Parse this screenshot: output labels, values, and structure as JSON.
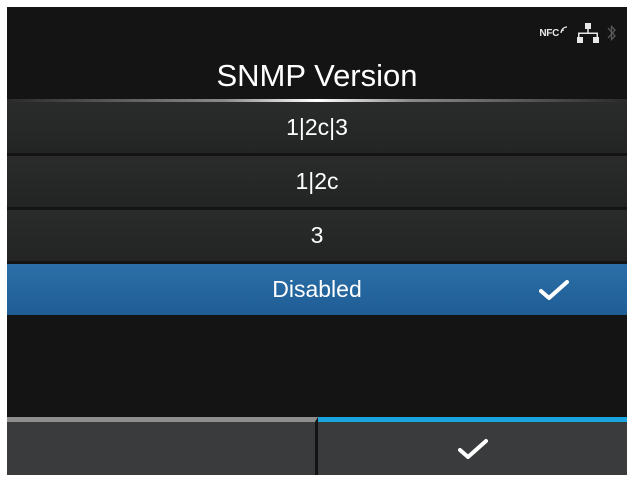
{
  "status_bar": {
    "nfc_label": "NFC",
    "icons": [
      "nfc-icon",
      "network-icon",
      "bluetooth-icon"
    ]
  },
  "header": {
    "title": "SNMP Version"
  },
  "options": [
    {
      "label": "1|2c|3",
      "selected": false
    },
    {
      "label": "1|2c",
      "selected": false
    },
    {
      "label": "3",
      "selected": false
    },
    {
      "label": "Disabled",
      "selected": true
    }
  ],
  "softkeys": {
    "left": {
      "icon": "none",
      "accent_color": "#8e8e8e"
    },
    "right": {
      "icon": "checkmark-icon",
      "accent_color": "#1aa4e0"
    }
  },
  "colors": {
    "background": "#141414",
    "row": "#262727",
    "selected_row": "#2567a0",
    "accent": "#1aa4e0"
  }
}
